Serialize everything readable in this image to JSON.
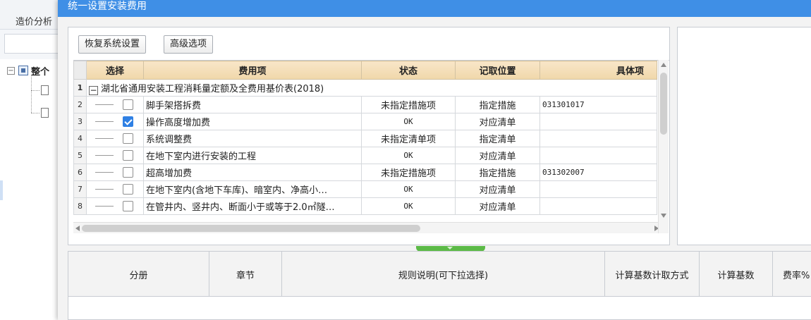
{
  "background_app": {
    "tab_label": "造价分析",
    "tree_root_label": "整个"
  },
  "dialog": {
    "title": "统一设置安装费用",
    "colors": {
      "titlebar": "#3f8fe6",
      "header": "#f0d7aa",
      "checkbox": "#2f80e4",
      "splitter": "#5cba47"
    }
  },
  "toolbar": {
    "restore_label": "恢复系统设置",
    "advanced_label": "高级选项"
  },
  "grid": {
    "columns": {
      "select": "选择",
      "fee_item": "费用项",
      "status": "状态",
      "position": "记取位置",
      "detail": "具体项"
    },
    "group": {
      "row_num": "1",
      "label": "湖北省通用安装工程消耗量定额及全费用基价表(2018)"
    },
    "rows": [
      {
        "num": "2",
        "checked": false,
        "name": "脚手架搭拆费",
        "status": "未指定措施项",
        "position": "指定措施",
        "detail": "031301017"
      },
      {
        "num": "3",
        "checked": true,
        "name": "操作高度增加费",
        "status": "OK",
        "position": "对应清单",
        "detail": ""
      },
      {
        "num": "4",
        "checked": false,
        "name": "系统调整费",
        "status": "未指定清单项",
        "position": "指定清单",
        "detail": ""
      },
      {
        "num": "5",
        "checked": false,
        "name": "在地下室内进行安装的工程",
        "status": "OK",
        "position": "对应清单",
        "detail": ""
      },
      {
        "num": "6",
        "checked": false,
        "name": "超高增加费",
        "status": "未指定措施项",
        "position": "指定措施",
        "detail": "031302007"
      },
      {
        "num": "7",
        "checked": false,
        "name": "在地下室内(含地下车库)、暗室内、净高小…",
        "status": "OK",
        "position": "对应清单",
        "detail": ""
      },
      {
        "num": "8",
        "checked": false,
        "name": "在管井内、竖井内、断面小于或等于2.0㎡隧…",
        "status": "OK",
        "position": "对应清单",
        "detail": ""
      }
    ]
  },
  "bottom_table": {
    "columns": [
      "分册",
      "章节",
      "规则说明(可下拉选择)",
      "计算基数计取方式",
      "计算基数",
      "费率%"
    ]
  }
}
